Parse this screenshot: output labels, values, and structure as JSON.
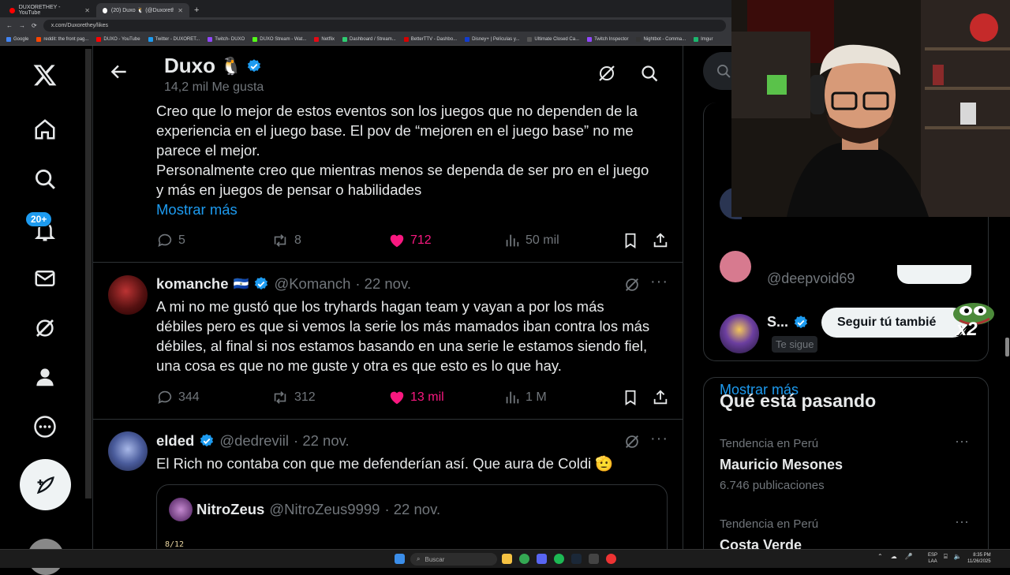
{
  "browser": {
    "tabs": [
      {
        "label": "DUXORETHEY - YouTube",
        "color": "#ff0000"
      },
      {
        "label": "(20) Duxo 🐧 (@Duxorethey) /",
        "color": "#ffffff"
      }
    ],
    "url": "x.com/Duxorethey/likes",
    "bookmarks": [
      {
        "label": "Google",
        "color": "#4285f4"
      },
      {
        "label": "reddit: the front pag...",
        "color": "#ff4500"
      },
      {
        "label": "DUXO - YouTube",
        "color": "#ff0000"
      },
      {
        "label": "Twitter - DUXORET...",
        "color": "#1d9bf0"
      },
      {
        "label": "Twitch- DUXO",
        "color": "#9146ff"
      },
      {
        "label": "DUXO Stream - Wat...",
        "color": "#53fc18"
      },
      {
        "label": "Netflix",
        "color": "#e50914"
      },
      {
        "label": "Dashboard / Stream...",
        "color": "#2ecc71"
      },
      {
        "label": "BetterTTV - Dashbo...",
        "color": "#d50000"
      },
      {
        "label": "Disney+ | Películas y...",
        "color": "#113ccf"
      },
      {
        "label": "Ultimate Closed Ca...",
        "color": "#555555"
      },
      {
        "label": "Twitch Inspector",
        "color": "#9146ff"
      },
      {
        "label": "Nightbot - Comma...",
        "color": "#333333"
      },
      {
        "label": "Imgur",
        "color": "#1bb76e"
      }
    ]
  },
  "nav": {
    "badge": "20+",
    "icons": [
      "x-logo-icon",
      "home-icon",
      "search-icon",
      "notifications-icon",
      "messages-icon",
      "grok-icon",
      "profile-icon",
      "more-icon"
    ]
  },
  "header": {
    "name": "Duxo",
    "emoji": "🐧",
    "likes": "14,2 mil Me gusta"
  },
  "tweets": [
    {
      "text_lines": [
        "Creo que lo mejor de estos eventos son los juegos que no dependen de la",
        "experiencia en el juego base. El pov de “mejoren en el juego base” no me",
        "parece el mejor.",
        "Personalmente creo que mientras menos se dependa de ser pro en el juego",
        "y más en juegos de pensar o habilidades"
      ],
      "show_more": "Mostrar más",
      "replies": "5",
      "reposts": "8",
      "likes": "712",
      "views": "50 mil"
    },
    {
      "name": "komanche",
      "flag": "🇸🇻",
      "handle": "@Komanch",
      "date": "· 22 nov.",
      "text_lines": [
        "A mi no me gustó que los tryhards hagan team y vayan a por los más",
        "débiles pero es que si vemos la serie los más mamados iban contra los más",
        "débiles, al final si nos estamos basando en una serie le estamos siendo fiel,",
        "una cosa es que no me guste y otra es que esto es lo que hay."
      ],
      "replies": "344",
      "reposts": "312",
      "likes": "13 mil",
      "views": "1 M"
    },
    {
      "name": "elded",
      "handle": "@dedreviil",
      "date": "· 22 nov.",
      "text": "El Rich no contaba con que me defenderían así. Que aura de Coldi 🫡",
      "quote": {
        "name": "NitroZeus",
        "handle": "@NitroZeus9999",
        "date": "· 22 nov.",
        "snippet": "8/12"
      }
    }
  ],
  "right": {
    "suggest1_handle": "@deepvoid69",
    "suggest2_name": "S...",
    "suggest2_badge": "Te sigue",
    "follow_back": "Seguir tú tambié",
    "show_more": "Mostrar más",
    "trending_title": "Qué está pasando",
    "trends": [
      {
        "context": "Tendencia en Perú",
        "title": "Mauricio Mesones",
        "count": "6.746 publicaciones"
      },
      {
        "context": "Tendencia en Perú",
        "title": "Costa Verde",
        "count": ""
      }
    ],
    "overlay_badge": "x2"
  },
  "taskbar": {
    "search": "Buscar",
    "lang1": "ESP",
    "lang2": "LAA",
    "time": "8:35 PM",
    "date": "11/26/2025"
  },
  "colors": {
    "accent": "#1d9bf0",
    "like": "#f91880",
    "muted": "#71767b"
  }
}
